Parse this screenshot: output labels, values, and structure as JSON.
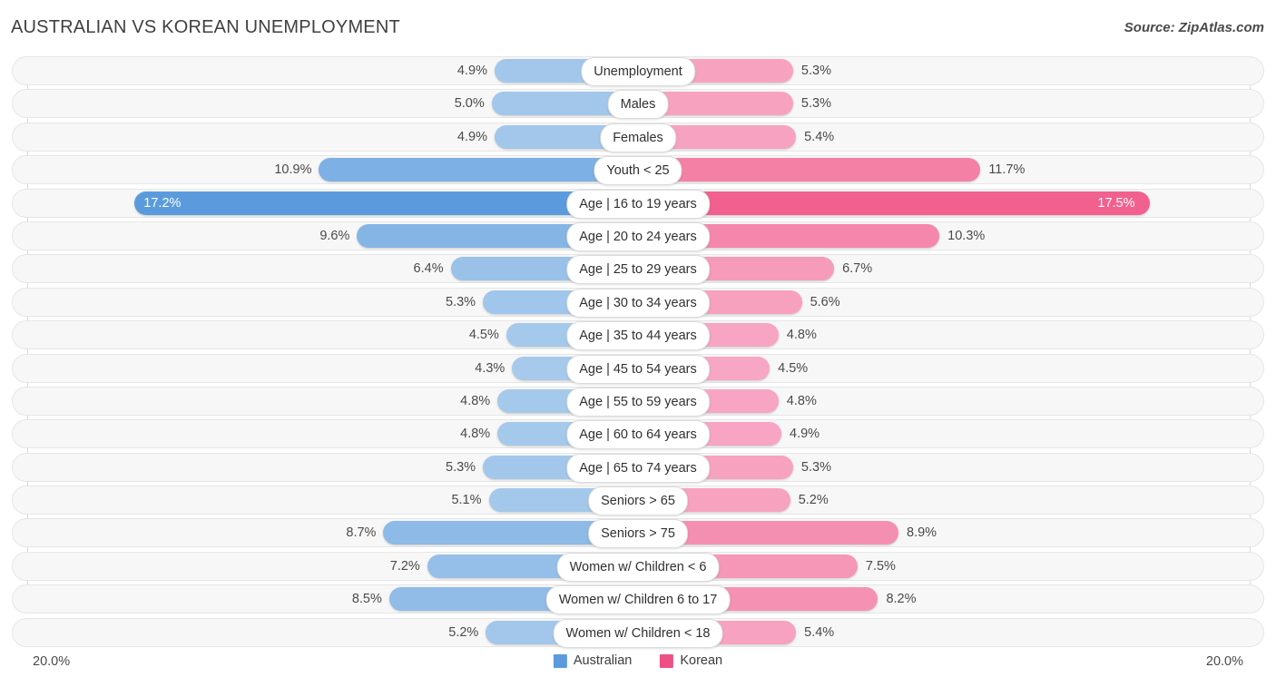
{
  "header": {
    "title": "AUSTRALIAN VS KOREAN UNEMPLOYMENT",
    "source": "Source: ZipAtlas.com"
  },
  "axis": {
    "left_label": "20.0%",
    "right_label": "20.0%",
    "max": 20.0
  },
  "legend": {
    "items": [
      {
        "label": "Australian",
        "color": "#5b9bdd"
      },
      {
        "label": "Korean",
        "color": "#ee4f84"
      }
    ]
  },
  "colors": {
    "left_light": "#a8cbec",
    "left_dark": "#5b9bdd",
    "right_light": "#f7a8c4",
    "right_dark": "#f2608f",
    "track_bg": "#f7f7f7",
    "track_border": "#e6e6e6",
    "gridline": "#d9d9d9"
  },
  "chart_data": {
    "type": "bar",
    "title": "AUSTRALIAN VS KOREAN UNEMPLOYMENT",
    "subtitle": "",
    "xlabel": "",
    "ylabel": "",
    "orientation": "horizontal-diverging",
    "grid": true,
    "legend_position": "bottom-center",
    "xlim": [
      20.0,
      20.0
    ],
    "categories": [
      "Unemployment",
      "Males",
      "Females",
      "Youth < 25",
      "Age | 16 to 19 years",
      "Age | 20 to 24 years",
      "Age | 25 to 29 years",
      "Age | 30 to 34 years",
      "Age | 35 to 44 years",
      "Age | 45 to 54 years",
      "Age | 55 to 59 years",
      "Age | 60 to 64 years",
      "Age | 65 to 74 years",
      "Seniors > 65",
      "Seniors > 75",
      "Women w/ Children < 6",
      "Women w/ Children 6 to 17",
      "Women w/ Children < 18"
    ],
    "series": [
      {
        "name": "Australian",
        "side": "left",
        "values": [
          4.9,
          5.0,
          4.9,
          10.9,
          17.2,
          9.6,
          6.4,
          5.3,
          4.5,
          4.3,
          4.8,
          4.8,
          5.3,
          5.1,
          8.7,
          7.2,
          8.5,
          5.2
        ],
        "labels": [
          "4.9%",
          "5.0%",
          "4.9%",
          "10.9%",
          "17.2%",
          "9.6%",
          "6.4%",
          "5.3%",
          "4.5%",
          "4.3%",
          "4.8%",
          "4.8%",
          "5.3%",
          "5.1%",
          "8.7%",
          "7.2%",
          "8.5%",
          "5.2%"
        ]
      },
      {
        "name": "Korean",
        "side": "right",
        "values": [
          5.3,
          5.3,
          5.4,
          11.7,
          17.5,
          10.3,
          6.7,
          5.6,
          4.8,
          4.5,
          4.8,
          4.9,
          5.3,
          5.2,
          8.9,
          7.5,
          8.2,
          5.4
        ],
        "labels": [
          "5.3%",
          "5.3%",
          "5.4%",
          "11.7%",
          "17.5%",
          "10.3%",
          "6.7%",
          "5.6%",
          "4.8%",
          "4.5%",
          "4.8%",
          "4.9%",
          "5.3%",
          "5.2%",
          "8.9%",
          "7.5%",
          "8.2%",
          "5.4%"
        ]
      }
    ]
  }
}
